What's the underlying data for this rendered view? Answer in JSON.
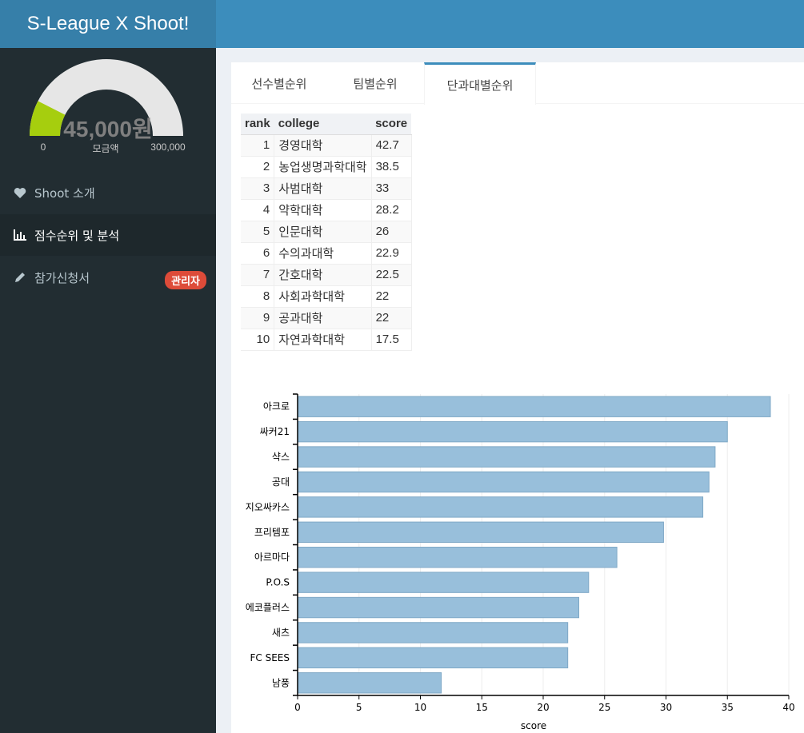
{
  "header": {
    "title": "S-League X Shoot!"
  },
  "gauge": {
    "value_text": "45,000원",
    "min": "0",
    "max": "300,000",
    "label": "모금액",
    "value": 45000,
    "max_value": 300000,
    "fill_color": "#a6ce0e"
  },
  "sidebar": {
    "items": [
      {
        "label": "Shoot 소개",
        "icon": "heart-icon"
      },
      {
        "label": "점수순위 및 분석",
        "icon": "bar-chart-icon"
      },
      {
        "label": "참가신청서",
        "icon": "pencil-icon",
        "badge": "관리자"
      }
    ]
  },
  "tabs": [
    {
      "label": "선수별순위"
    },
    {
      "label": "팀별순위"
    },
    {
      "label": "단과대별순위"
    }
  ],
  "table": {
    "headers": [
      "rank",
      "college",
      "score"
    ],
    "rows": [
      [
        "1",
        "경영대학",
        "42.7"
      ],
      [
        "2",
        "농업생명과학대학",
        "38.5"
      ],
      [
        "3",
        "사범대학",
        "33"
      ],
      [
        "4",
        "약학대학",
        "28.2"
      ],
      [
        "5",
        "인문대학",
        "26"
      ],
      [
        "6",
        "수의과대학",
        "22.9"
      ],
      [
        "7",
        "간호대학",
        "22.5"
      ],
      [
        "8",
        "사회과학대학",
        "22"
      ],
      [
        "9",
        "공과대학",
        "22"
      ],
      [
        "10",
        "자연과학대학",
        "17.5"
      ]
    ]
  },
  "chart_data": {
    "type": "bar",
    "orientation": "horizontal",
    "categories": [
      "아크로",
      "싸커21",
      "샥스",
      "공대",
      "지오싸카스",
      "프리템포",
      "아르마다",
      "P.O.S",
      "에코플러스",
      "새츠",
      "FC SEES",
      "남풍"
    ],
    "values": [
      38.5,
      35,
      34,
      33.5,
      33,
      29.8,
      26,
      23.7,
      22.9,
      22,
      22,
      11.7
    ],
    "xlabel": "score",
    "xlim": [
      0,
      40
    ],
    "xticks": [
      0,
      5,
      10,
      15,
      20,
      25,
      30,
      35,
      40
    ],
    "bar_color": "#98bfdb",
    "grid": true
  }
}
